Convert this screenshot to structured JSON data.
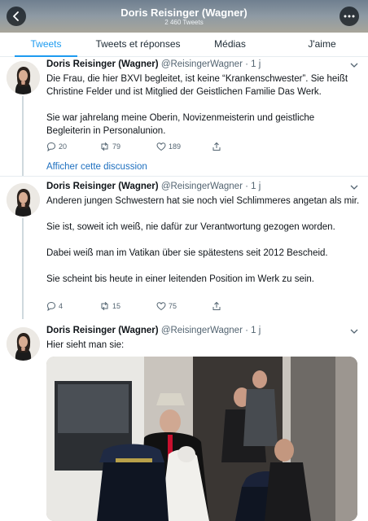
{
  "header": {
    "title": "Doris Reisinger (Wagner)",
    "tweet_count": "2 460 Tweets"
  },
  "tabs": [
    {
      "label": "Tweets",
      "active": true
    },
    {
      "label": "Tweets et réponses",
      "active": false
    },
    {
      "label": "Médias",
      "active": false
    },
    {
      "label": "J'aime",
      "active": false
    }
  ],
  "tweets": [
    {
      "name": "Doris Reisinger (Wagner)",
      "handle": "@ReisingerWagner",
      "time": "· 1 j",
      "paragraphs": [
        "Die Frau, die hier BXVI begleitet, ist keine “Krankenschwester”. Sie heißt Christine Felder und ist Mitglied der Geistlichen Familie Das Werk.",
        "Sie war jahrelang meine Oberin, Novizenmeisterin und geistliche Begleiterin in Personalunion."
      ],
      "replies": "20",
      "retweets": "79",
      "likes": "189",
      "show_thread": "Afficher cette discussion"
    },
    {
      "name": "Doris Reisinger (Wagner)",
      "handle": "@ReisingerWagner",
      "time": "· 1 j",
      "paragraphs": [
        "Anderen jungen Schwestern hat sie noch viel Schlimmeres angetan als mir.",
        "Sie ist, soweit ich weiß, nie dafür zur Verantwortung gezogen worden.",
        "Dabei weiß man im Vatikan über sie spätestens seit 2012 Bescheid.",
        "Sie scheint bis heute in einer leitenden Position im Werk zu sein."
      ],
      "replies": "4",
      "retweets": "15",
      "likes": "75"
    },
    {
      "name": "Doris Reisinger (Wagner)",
      "handle": "@ReisingerWagner",
      "time": "· 1 j",
      "paragraphs": [
        "Hier sieht man sie:"
      ]
    }
  ],
  "colors": {
    "accent": "#1d9bf0",
    "link": "#1d6fbf",
    "muted": "#536471"
  }
}
